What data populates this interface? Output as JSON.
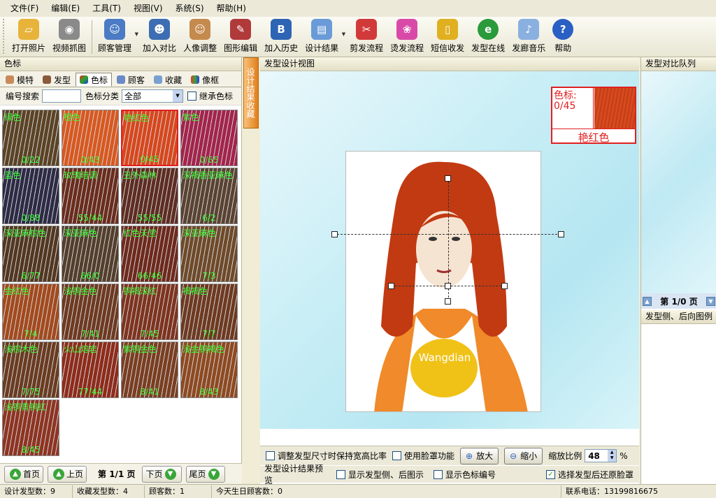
{
  "menu": [
    "文件(F)",
    "编辑(E)",
    "工具(T)",
    "视图(V)",
    "系统(S)",
    "帮助(H)"
  ],
  "toolbar": {
    "open_photo": "打开照片",
    "video_capture": "视频抓图",
    "customer_mgmt": "顾客管理",
    "add_compare": "加入对比",
    "portrait_adjust": "人像调整",
    "graphic_edit": "图形编辑",
    "add_history": "加入历史",
    "design_result": "设计结果",
    "cut_flow": "剪发流程",
    "perm_flow": "烫发流程",
    "sms": "短信收发",
    "hairstyle_online": "发型在线",
    "salon_music": "发廊音乐",
    "help": "帮助"
  },
  "left_panel": {
    "title": "色标",
    "tabs": [
      "模特",
      "发型",
      "色标",
      "顾客",
      "收藏",
      "像框"
    ],
    "search_label": "编号搜索",
    "search_value": "",
    "category_label": "色标分类",
    "category_value": "全部",
    "inherit_label": "继承色标",
    "swatches": [
      {
        "name": "绿色",
        "code": "0/22",
        "color": "#5b4326"
      },
      {
        "name": "橙色",
        "code": "0/43",
        "color": "#d9581f"
      },
      {
        "name": "艳红色",
        "code": "0/45",
        "color": "#d8471d"
      },
      {
        "name": "紫色",
        "code": "0/65",
        "color": "#a3244c"
      },
      {
        "name": "蓝色",
        "code": "0/88",
        "color": "#2d2b45"
      },
      {
        "name": "玫瑰暗调",
        "code": "55/44",
        "color": "#6a2d1e"
      },
      {
        "name": "丑外森林",
        "code": "55/55",
        "color": "#5e2d22"
      },
      {
        "name": "深褐香亚麻色",
        "code": "6/2",
        "color": "#5a4332"
      },
      {
        "name": "深亚麻棕色",
        "code": "6/77",
        "color": "#523722"
      },
      {
        "name": "深亚麻色",
        "code": "66/0",
        "color": "#533f2c"
      },
      {
        "name": "红色天堂",
        "code": "66/46",
        "color": "#6e2a1e"
      },
      {
        "name": "深亚麻色",
        "code": "7/3",
        "color": "#6e4a2b"
      },
      {
        "name": "金红色",
        "code": "7/4",
        "color": "#a34a1e"
      },
      {
        "name": "浅铜金色",
        "code": "7/41",
        "color": "#6e3a22"
      },
      {
        "name": "铜褐深红",
        "code": "7/45",
        "color": "#7e3420"
      },
      {
        "name": "褐褐色",
        "code": "7/7",
        "color": "#6e3a22"
      },
      {
        "name": "浅棕木色",
        "code": "7/75",
        "color": "#6a3c22"
      },
      {
        "name": "火山熔岩",
        "code": "77/44",
        "color": "#8e2c1c"
      },
      {
        "name": "紫铜金色",
        "code": "8/41",
        "color": "#7a3e22"
      },
      {
        "name": "浅金铜褐色",
        "code": "8/43",
        "color": "#8e4a22"
      },
      {
        "name": "浅铜青铜红",
        "code": "8/45",
        "color": "#8e3422"
      }
    ],
    "pager": {
      "first": "首页",
      "prev": "上页",
      "page": "第 1/1 页",
      "next": "下页",
      "last": "尾页"
    }
  },
  "vertical_tab": "设计结果收藏",
  "center": {
    "title": "发型设计视图",
    "color_label": "色标:",
    "color_code": "0/45",
    "color_name": "艳红色",
    "photo_text": "Wangdian",
    "keep_ratio": "调整发型尺寸时保持宽高比率",
    "face_mask": "使用脸罩功能",
    "zoom_in": "放大",
    "zoom_out": "缩小",
    "zoom_label": "缩放比例",
    "zoom_value": "48",
    "zoom_unit": "%",
    "preview_label": "发型设计结果预览",
    "show_side": "显示发型侧、后图示",
    "show_code": "显示色标编号",
    "restore_face": "选择发型后还原脸罩"
  },
  "right_panel": {
    "queue_title": "发型对比队列",
    "page": "第 1/0 页",
    "side_title": "发型侧、后向图例"
  },
  "status": {
    "design_count": "设计发型数：9",
    "fav_count": "收藏发型数：4",
    "customer_count": "顾客数：1",
    "birthday": "今天生日顾客数：0",
    "phone": "联系电话：13199816675"
  },
  "colors": {
    "accent_red": "#e02020",
    "label_green": "#3aff3a",
    "toolbar_bg": "#ece9d8"
  }
}
